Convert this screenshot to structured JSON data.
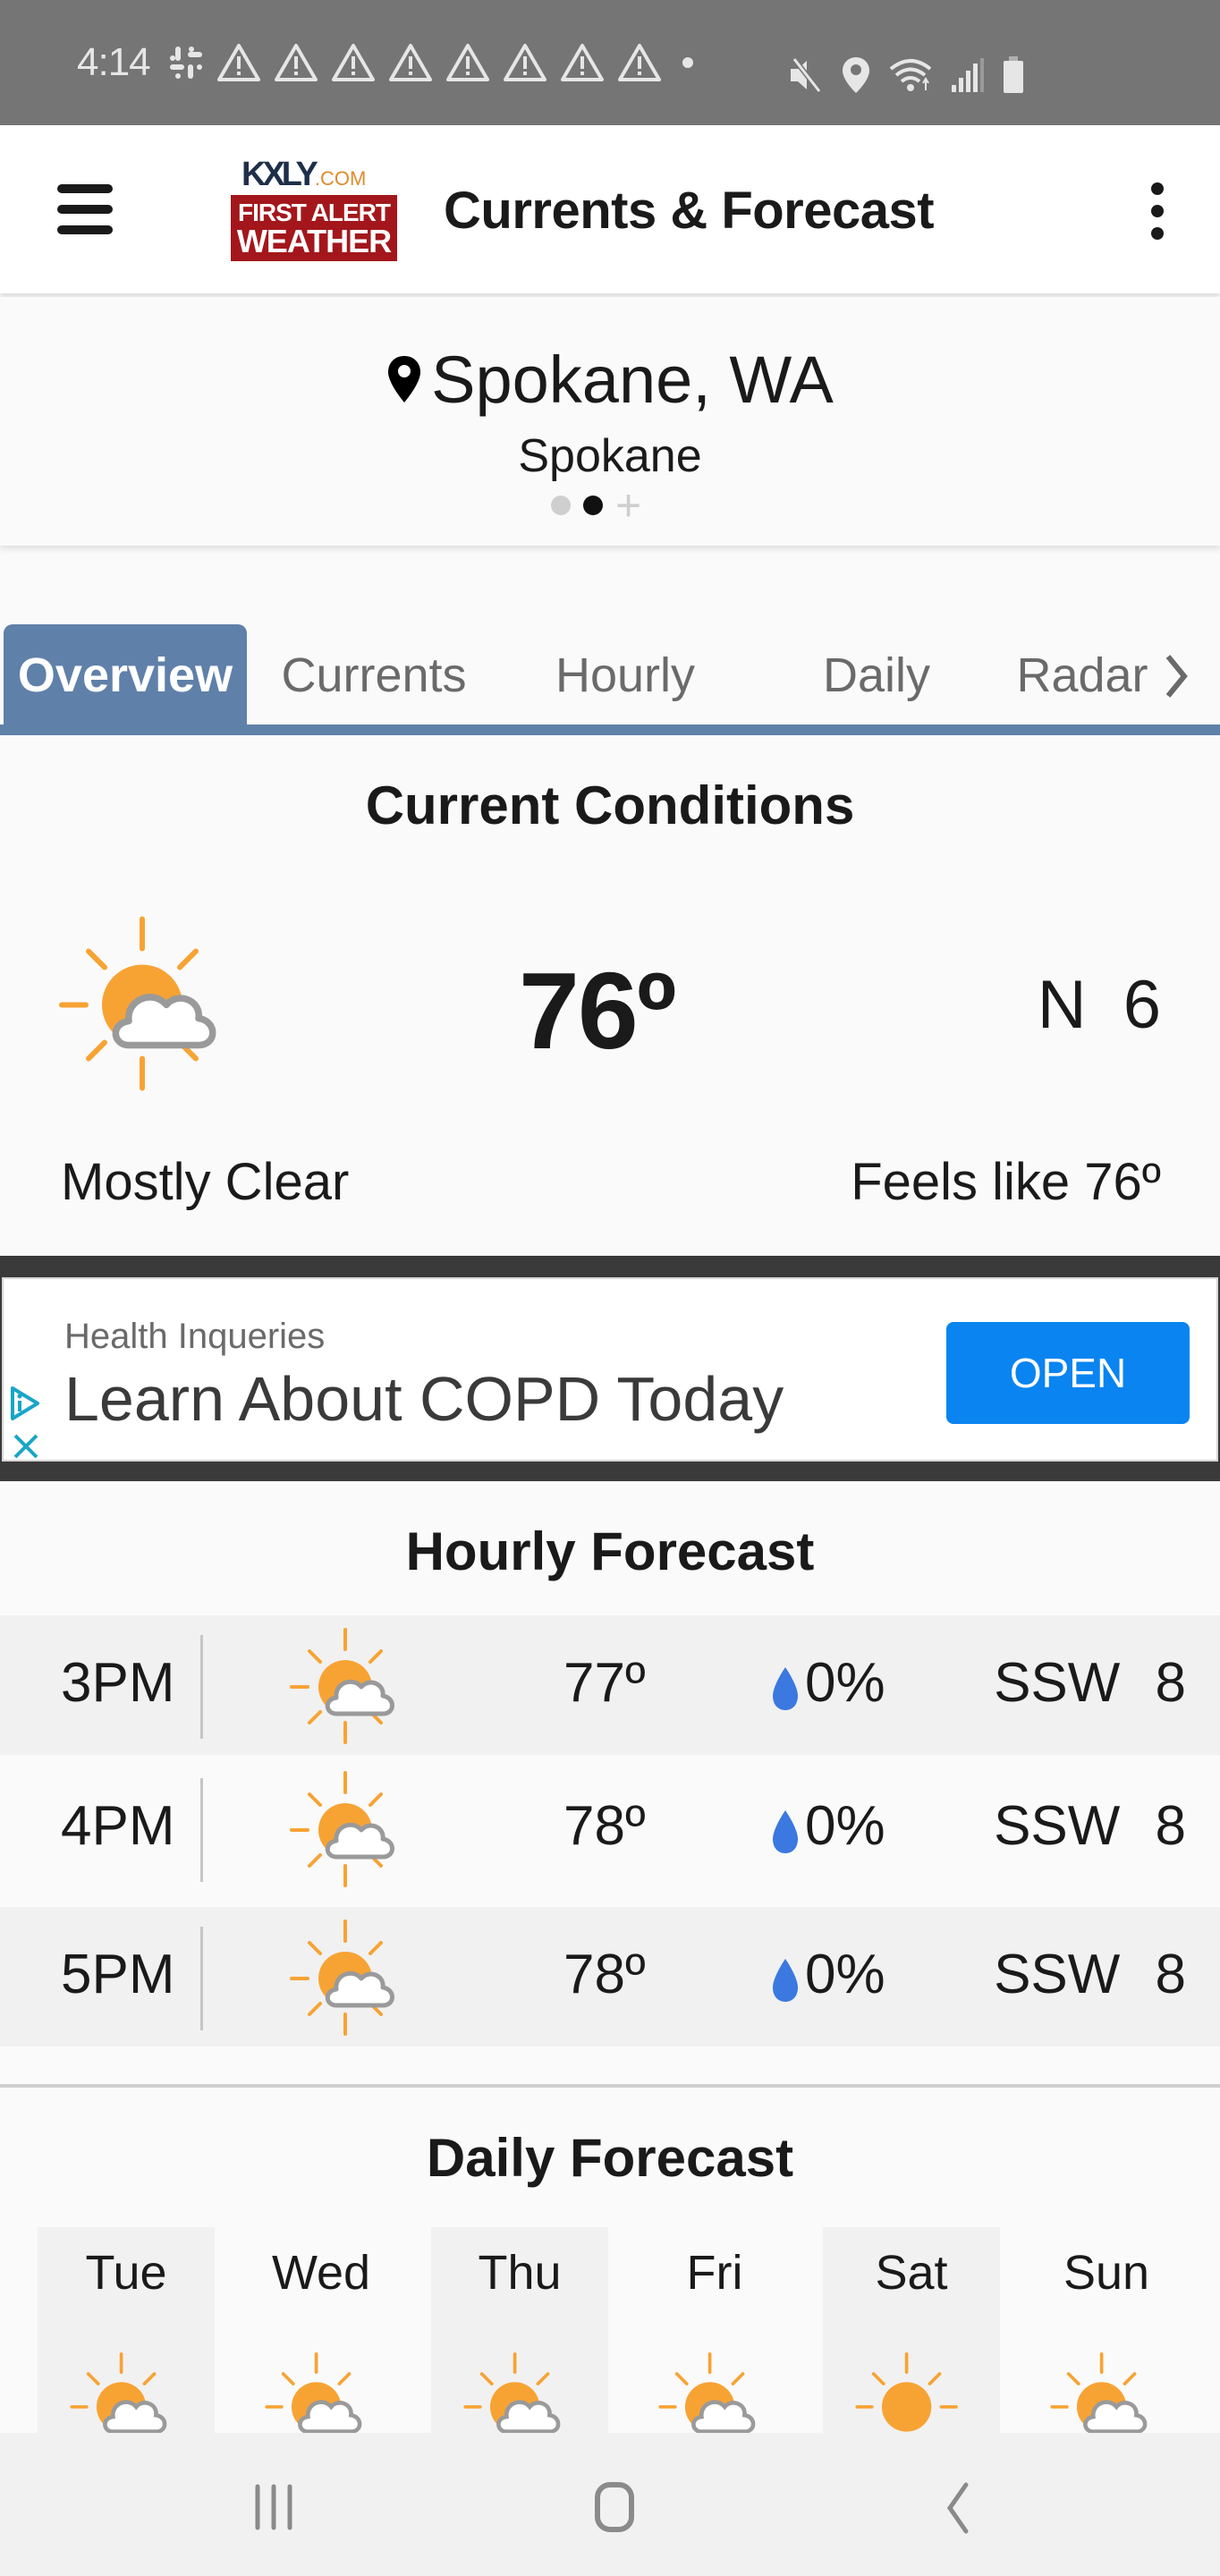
{
  "status_bar": {
    "time": "4:14",
    "left_icons": [
      "slack-icon",
      "warning-icon",
      "warning-icon",
      "warning-icon",
      "warning-icon",
      "warning-icon",
      "warning-icon",
      "warning-icon",
      "warning-icon",
      "dot-icon"
    ],
    "right_icons": [
      "mute-icon",
      "location-icon",
      "wifi-icon",
      "signal-icon",
      "battery-icon"
    ]
  },
  "app_bar": {
    "logo_top": "KXLY",
    "logo_top_suffix": ".COM",
    "logo_line1": "FIRST ALERT",
    "logo_line2": "WEATHER",
    "title": "Currents & Forecast"
  },
  "location": {
    "title": "Spokane, WA",
    "subtitle": "Spokane",
    "pager": {
      "count": 2,
      "active_index": 1
    }
  },
  "tabs": [
    {
      "label": "Overview",
      "active": true
    },
    {
      "label": "Currents",
      "active": false
    },
    {
      "label": "Hourly",
      "active": false
    },
    {
      "label": "Daily",
      "active": false
    },
    {
      "label": "Radar",
      "active": false
    }
  ],
  "current": {
    "section_title": "Current Conditions",
    "icon": "partly-sunny-icon",
    "temperature": "76º",
    "wind": "N 6",
    "condition": "Mostly Clear",
    "feels_like": "Feels like 76º"
  },
  "ad": {
    "source": "Health Inqueries",
    "headline": "Learn About COPD Today",
    "button": "OPEN"
  },
  "hourly": {
    "section_title": "Hourly Forecast",
    "rows": [
      {
        "time": "3PM",
        "icon": "partly-sunny-icon",
        "temp": "77º",
        "precip": "0%",
        "wind": "SSW 8"
      },
      {
        "time": "4PM",
        "icon": "partly-sunny-icon",
        "temp": "78º",
        "precip": "0%",
        "wind": "SSW 8"
      },
      {
        "time": "5PM",
        "icon": "partly-sunny-icon",
        "temp": "78º",
        "precip": "0%",
        "wind": "SSW 8"
      }
    ]
  },
  "daily": {
    "section_title": "Daily Forecast",
    "days": [
      {
        "day": "Tue",
        "icon": "partly-sunny-icon"
      },
      {
        "day": "Wed",
        "icon": "partly-sunny-icon"
      },
      {
        "day": "Thu",
        "icon": "partly-sunny-icon"
      },
      {
        "day": "Fri",
        "icon": "partly-sunny-icon"
      },
      {
        "day": "Sat",
        "icon": "sunny-icon"
      },
      {
        "day": "Sun",
        "icon": "partly-sunny-icon"
      }
    ]
  },
  "colors": {
    "tab_accent": "#5f80a9",
    "sun": "#f7a334",
    "cloud_outline": "#9a9a9a",
    "precip_drop": "#3b78e0",
    "ad_button": "#0a84f0",
    "logo_red": "#a3171c"
  }
}
